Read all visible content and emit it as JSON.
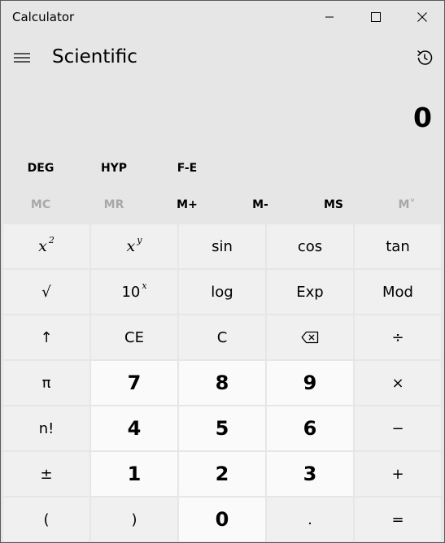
{
  "window": {
    "title": "Calculator"
  },
  "header": {
    "mode": "Scientific"
  },
  "display": {
    "value": "0"
  },
  "mode_row": [
    "DEG",
    "HYP",
    "F-E"
  ],
  "memory_row": [
    {
      "label": "MC",
      "enabled": false
    },
    {
      "label": "MR",
      "enabled": false
    },
    {
      "label": "M+",
      "enabled": true
    },
    {
      "label": "M-",
      "enabled": true
    },
    {
      "label": "MS",
      "enabled": true
    },
    {
      "label": "M˅",
      "enabled": false
    }
  ],
  "keypad": {
    "rows": [
      [
        "x",
        "x",
        "sin",
        "cos",
        "tan"
      ],
      [
        "√",
        "10",
        "log",
        "Exp",
        "Mod"
      ],
      [
        "↑",
        "CE",
        "C",
        "⌫",
        "÷"
      ],
      [
        "π",
        "7",
        "8",
        "9",
        "×"
      ],
      [
        "n!",
        "4",
        "5",
        "6",
        "−"
      ],
      [
        "±",
        "1",
        "2",
        "3",
        "+"
      ],
      [
        "(",
        ")",
        "0",
        ".",
        "="
      ]
    ],
    "superscripts": {
      "x_squared": "2",
      "x_power": "y",
      "ten_power": "x"
    }
  },
  "colors": {
    "window_bg": "#e6e6e6",
    "key_bg": "#f0f0f0",
    "number_key_bg": "#fafafa",
    "disabled_text": "#a8a8a8"
  }
}
